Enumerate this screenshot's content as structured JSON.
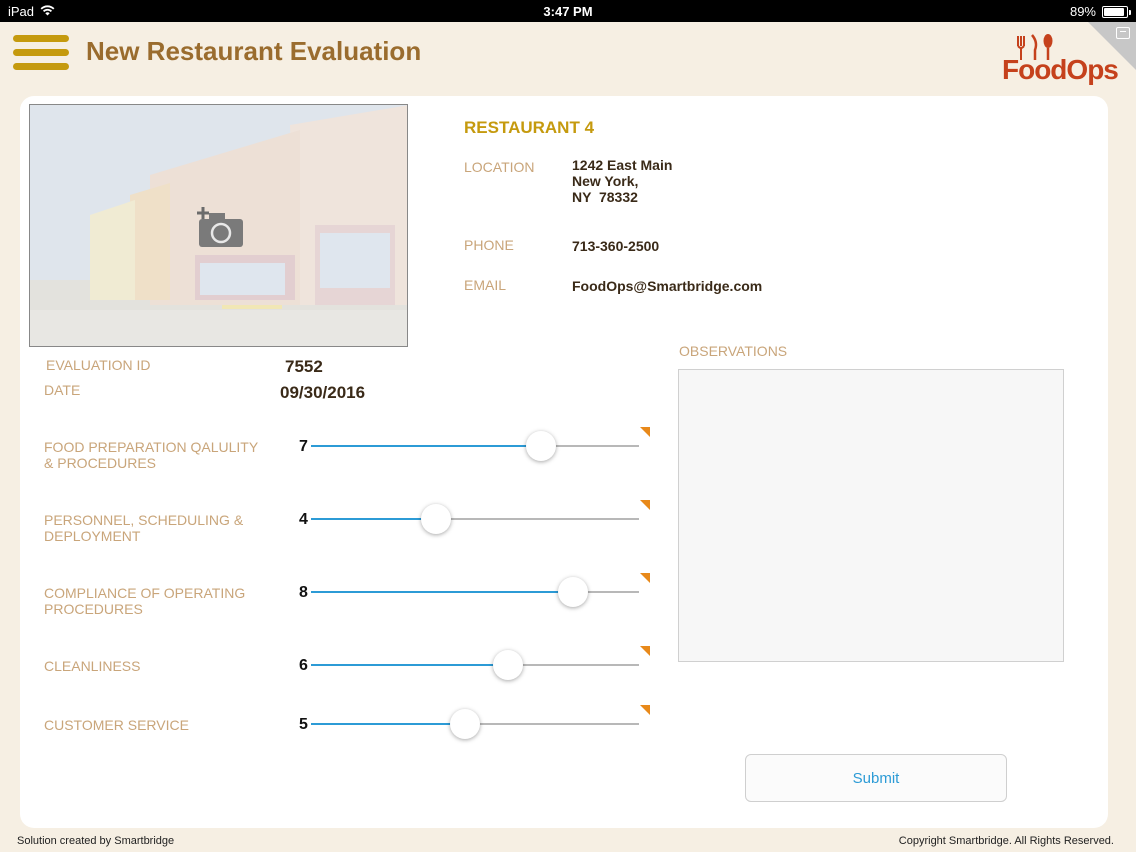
{
  "status_bar": {
    "device": "iPad",
    "time": "3:47 PM",
    "battery": "89%",
    "battery_level": 0.89
  },
  "header": {
    "title": "New Restaurant Evaluation",
    "logo_text": "FoodOps"
  },
  "restaurant": {
    "name": "RESTAURANT 4",
    "location_label": "LOCATION",
    "address_line1": "1242 East Main",
    "address_line2": "New York,",
    "address_line3": "NY  78332",
    "phone_label": "PHONE",
    "phone": "713-360-2500",
    "email_label": "EMAIL",
    "email": "FoodOps@Smartbridge.com"
  },
  "evaluation": {
    "id_label": "EVALUATION ID",
    "id": "7552",
    "date_label": "DATE",
    "date": "09/30/2016"
  },
  "criteria": [
    {
      "label_line1": "FOOD PREPARATION QALULITY",
      "label_line2": "& PROCEDURES",
      "value": "7",
      "level": 0.7
    },
    {
      "label_line1": "PERSONNEL, SCHEDULING &",
      "label_line2": "DEPLOYMENT",
      "value": "4",
      "level": 0.38
    },
    {
      "label_line1": "COMPLIANCE OF OPERATING",
      "label_line2": "PROCEDURES",
      "value": "8",
      "level": 0.8
    },
    {
      "label_line1": "CLEANLINESS",
      "label_line2": "",
      "value": "6",
      "level": 0.6
    },
    {
      "label_line1": "CUSTOMER SERVICE",
      "label_line2": "",
      "value": "5",
      "level": 0.47
    }
  ],
  "observations": {
    "label": "OBSERVATIONS",
    "value": ""
  },
  "submit_label": "Submit",
  "footer": {
    "left": "Solution created by Smartbridge",
    "right": "Copyright Smartbridge. All Rights Reserved."
  },
  "colors": {
    "accent": "#c59a0e",
    "title": "#9a6c2e",
    "label": "#c9a57a",
    "slider": "#2c9bd6",
    "flag": "#e8891a",
    "logo": "#c5411c"
  },
  "icons": {
    "menu": "hamburger-icon",
    "photo": "add-photo-camera-icon",
    "wifi": "wifi-icon",
    "battery": "battery-icon",
    "logo": "fork-knife-spoon-logo"
  }
}
